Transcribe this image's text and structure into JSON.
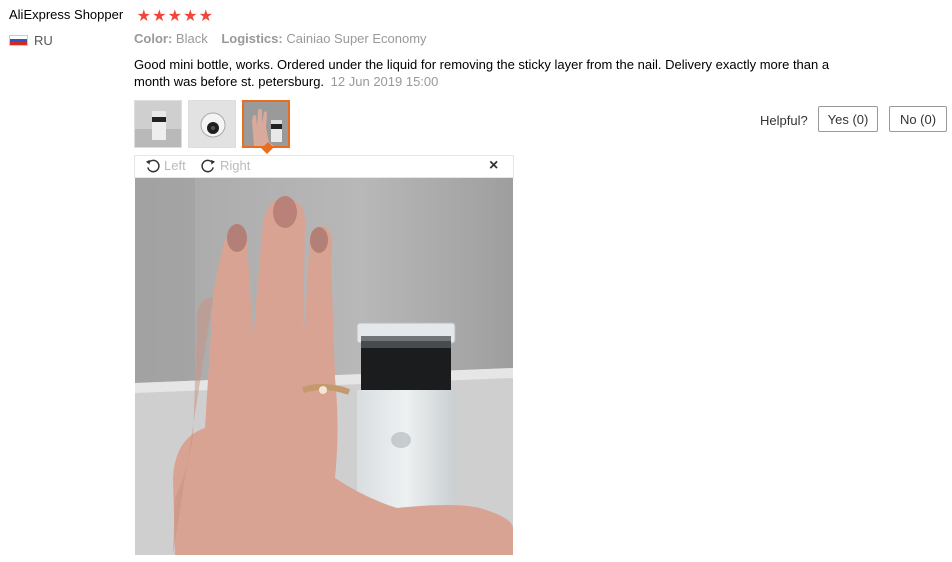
{
  "review": {
    "author": "AliExpress Shopper",
    "rating_stars": 5,
    "star_glyph": "★",
    "country": "RU",
    "flag_colors": [
      "#ffffff",
      "#2b59c3",
      "#d52b1e"
    ],
    "color_label": "Color:",
    "color_value": "Black",
    "logistics_label": "Logistics:",
    "logistics_value": "Cainiao Super Economy",
    "text": "Good mini bottle, works. Ordered under the liquid for removing the sticky layer from the nail. Delivery exactly more than a month was before st. petersburg.",
    "date": "12 Jun 2019 15:00"
  },
  "thumbnails": [
    {
      "name": "bottle-photo-1",
      "selected": false
    },
    {
      "name": "bottle-photo-2",
      "selected": false
    },
    {
      "name": "hand-bottle-photo",
      "selected": true
    }
  ],
  "helpful": {
    "label": "Helpful?",
    "yes_label": "Yes (0)",
    "no_label": "No (0)"
  },
  "viewer": {
    "rotate_left_label": "Left",
    "rotate_right_label": "Right",
    "close_glyph": "×"
  },
  "colors": {
    "star": "#f0473a",
    "thumb_selected_border": "#e86d1f"
  }
}
